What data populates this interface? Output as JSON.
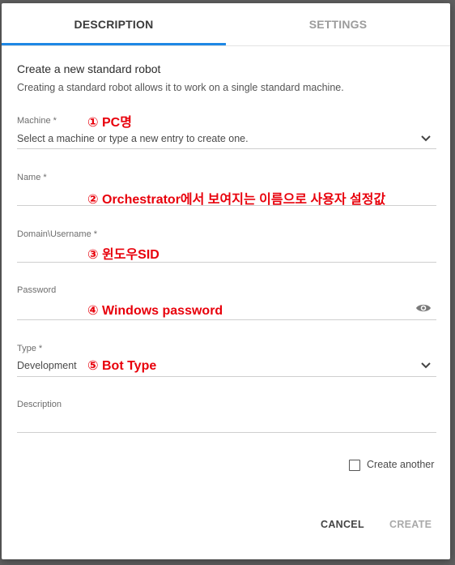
{
  "tabs": [
    {
      "label": "DESCRIPTION",
      "active": true
    },
    {
      "label": "SETTINGS",
      "active": false
    }
  ],
  "colors": {
    "accent": "#1e88e5",
    "annotation": "#e8000b"
  },
  "form": {
    "heading": "Create a new standard robot",
    "subheading": "Creating a standard robot allows it to work on a single standard machine.",
    "fields": {
      "machine": {
        "label": "Machine *",
        "placeholder": "Select a machine or type a new entry to create one.",
        "annotation": "① PC명",
        "icon": "chevron-down-icon"
      },
      "name": {
        "label": "Name *",
        "annotation": "② Orchestrator에서 보여지는 이름으로 사용자 설정값"
      },
      "username": {
        "label": "Domain\\Username *",
        "annotation": "③ 윈도우SID"
      },
      "password": {
        "label": "Password",
        "annotation": "④ Windows password",
        "icon": "eye-icon"
      },
      "type": {
        "label": "Type *",
        "value": "Development",
        "annotation": "⑤ Bot Type",
        "icon": "chevron-down-icon"
      },
      "description": {
        "label": "Description"
      }
    },
    "create_another": {
      "label": "Create another",
      "checked": false
    }
  },
  "actions": {
    "cancel_label": "CANCEL",
    "create_label": "CREATE",
    "create_enabled": false
  }
}
